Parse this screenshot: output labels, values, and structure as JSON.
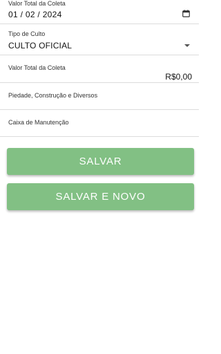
{
  "form": {
    "date_field": {
      "label": "Valor Total da Coleta",
      "value": "01 / 02 / 2024",
      "icon": "calendar-icon"
    },
    "tipo_field": {
      "label": "Tipo de Culto",
      "value": "CULTO OFICIAL",
      "icon": "dropdown-arrow-icon"
    },
    "valor_field": {
      "label": "Valor Total da Coleta",
      "value": "R$0,00"
    },
    "piedade_field": {
      "label": "Piedade, Construção e Diversos"
    },
    "caixa_field": {
      "label": "Caixa de Manutenção"
    }
  },
  "actions": {
    "save_label": "SALVAR",
    "save_new_label": "SALVAR E NOVO",
    "button_color": "#82c084",
    "button_text_color": "#ffffff"
  }
}
